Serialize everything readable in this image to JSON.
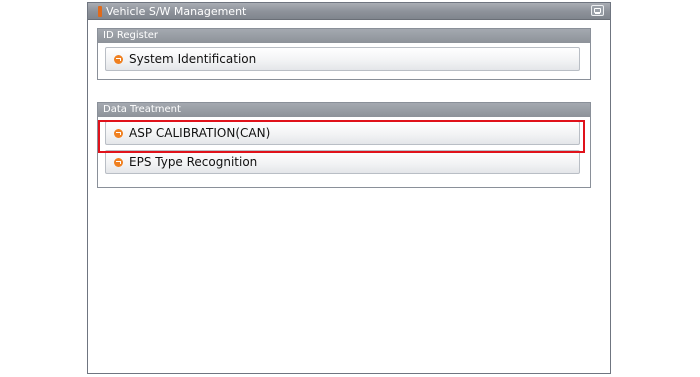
{
  "window": {
    "title": "Vehicle S/W Management",
    "title_icon": "monitor-icon"
  },
  "groups": [
    {
      "header": "ID Register",
      "items": [
        {
          "label": "System Identification",
          "icon": "orange-arrow-bullet-icon"
        }
      ]
    },
    {
      "header": "Data Treatment",
      "items": [
        {
          "label": "ASP CALIBRATION(CAN)",
          "icon": "orange-arrow-bullet-icon",
          "highlighted": true
        },
        {
          "label": "EPS Type Recognition",
          "icon": "orange-arrow-bullet-icon"
        }
      ]
    }
  ],
  "colors": {
    "highlight": "#e0121b",
    "bullet": "#f08020",
    "title_accent": "#e06a1a"
  }
}
